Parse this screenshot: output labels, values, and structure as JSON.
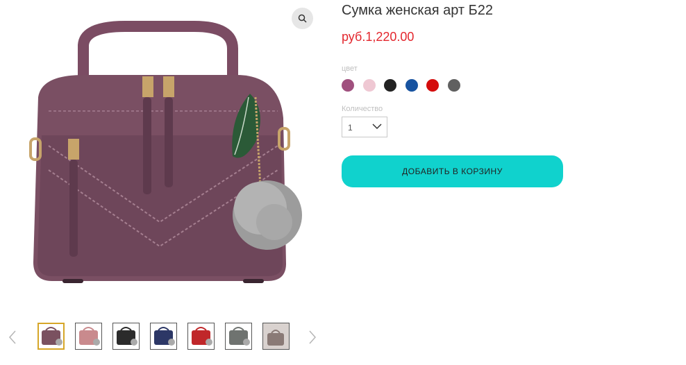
{
  "product": {
    "title": "Сумка женская арт Б22",
    "price": "руб.1,220.00"
  },
  "options": {
    "color_label": "цвет",
    "colors": [
      {
        "name": "plum",
        "hex": "#a0507e"
      },
      {
        "name": "pink",
        "hex": "#efc8d3"
      },
      {
        "name": "black",
        "hex": "#222222"
      },
      {
        "name": "blue",
        "hex": "#1753a0"
      },
      {
        "name": "red",
        "hex": "#d40c0c"
      },
      {
        "name": "gray",
        "hex": "#606060"
      }
    ],
    "quantity_label": "Количество",
    "quantity_value": "1"
  },
  "actions": {
    "add_to_cart_label": "ДОБАВИТЬ В КОРЗИНУ",
    "button_color": "#10d2cd"
  },
  "gallery": {
    "main_image_icon": "handbag-image",
    "zoom_icon": "magnifier-icon",
    "thumbnails": [
      {
        "color": "#7a5160",
        "selected": true
      },
      {
        "color": "#c98a8d",
        "selected": false
      },
      {
        "color": "#2b2b2b",
        "selected": false
      },
      {
        "color": "#2c3766",
        "selected": false
      },
      {
        "color": "#c0272a",
        "selected": false
      },
      {
        "color": "#6f7370",
        "selected": false
      },
      {
        "color": "#8a7a76",
        "selected": false
      }
    ]
  }
}
